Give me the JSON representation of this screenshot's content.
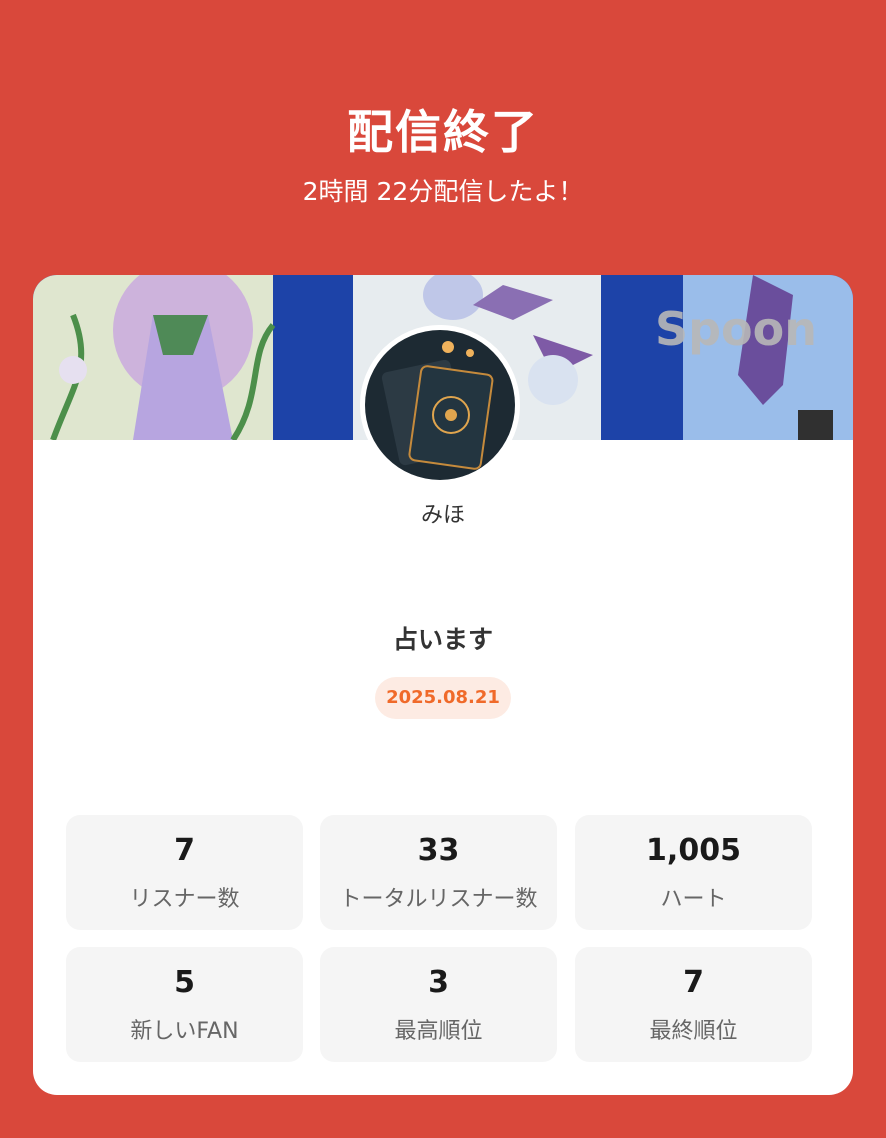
{
  "header": {
    "title": "配信終了",
    "subtitle": "2時間 22分配信したよ！"
  },
  "profile": {
    "username": "みほ",
    "banner_watermark": "Spoon"
  },
  "live": {
    "title": "占います",
    "date": "2025.08.21"
  },
  "stats": [
    {
      "value": "7",
      "label": "リスナー数"
    },
    {
      "value": "33",
      "label": "トータルリスナー数"
    },
    {
      "value": "1,005",
      "label": "ハート"
    },
    {
      "value": "5",
      "label": "新しいFAN"
    },
    {
      "value": "3",
      "label": "最高順位"
    },
    {
      "value": "7",
      "label": "最終順位"
    }
  ],
  "colors": {
    "background": "#d9483b",
    "accent": "#f06a2a",
    "badge_bg": "#fdebe3",
    "stat_bg": "#f5f5f5"
  }
}
